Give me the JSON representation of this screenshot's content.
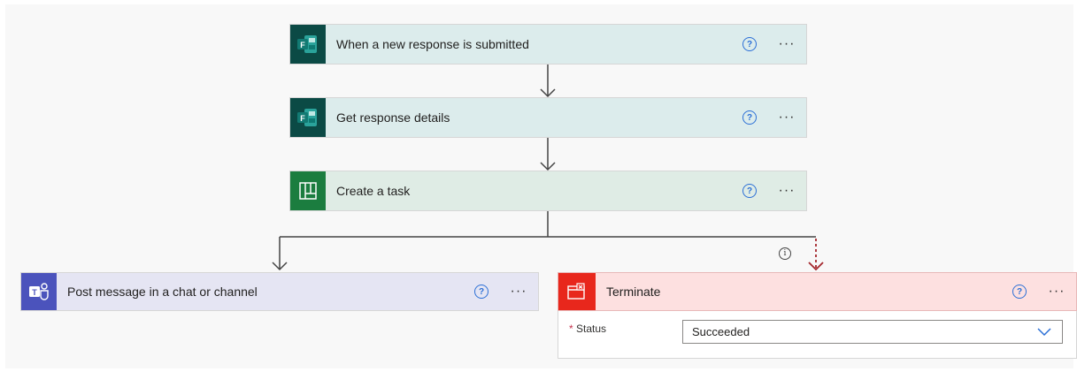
{
  "steps": {
    "trigger": {
      "title": "When a new response is submitted",
      "icon": "forms-icon",
      "help": "?",
      "more": "···"
    },
    "get_details": {
      "title": "Get response details",
      "icon": "forms-icon",
      "help": "?",
      "more": "···"
    },
    "create_task": {
      "title": "Create a task",
      "icon": "planner-icon",
      "help": "?",
      "more": "···"
    },
    "post_message": {
      "title": "Post message in a chat or channel",
      "icon": "teams-icon",
      "help": "?",
      "more": "···"
    },
    "terminate": {
      "title": "Terminate",
      "icon": "terminate-icon",
      "help": "?",
      "more": "···",
      "status_label": "Status",
      "required_mark": "*",
      "status_value": "Succeeded"
    }
  },
  "run_after_info": "i",
  "colors": {
    "forms": "#0b4a45",
    "planner": "#1b7d3f",
    "teams": "#4b53bc",
    "terminate": "#e8271c",
    "help_blue": "#2b6fd6",
    "run_after_red": "#a4262c"
  }
}
